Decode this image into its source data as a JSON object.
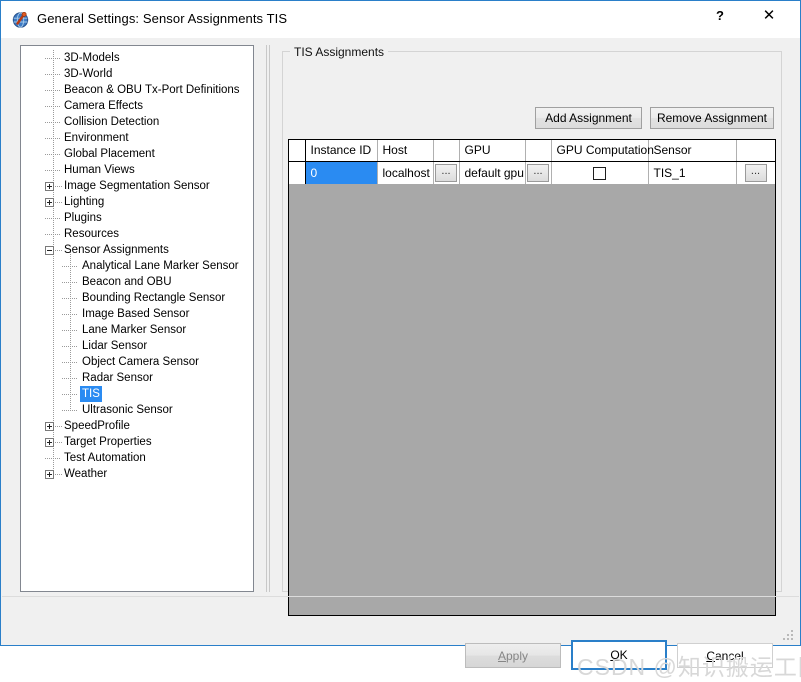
{
  "window": {
    "title": "General Settings: Sensor Assignments TIS",
    "icon": "globe-sensor-icon",
    "help_label": "?",
    "close_label": "✕",
    "accent_color": "#2a7fc9",
    "selection_color": "#2a8bf2"
  },
  "tree": {
    "items": [
      {
        "label": "3D-Models",
        "depth": 1,
        "expander": "none",
        "selected": false
      },
      {
        "label": "3D-World",
        "depth": 1,
        "expander": "none",
        "selected": false
      },
      {
        "label": "Beacon & OBU Tx-Port Definitions",
        "depth": 1,
        "expander": "none",
        "selected": false
      },
      {
        "label": "Camera Effects",
        "depth": 1,
        "expander": "none",
        "selected": false
      },
      {
        "label": "Collision Detection",
        "depth": 1,
        "expander": "none",
        "selected": false
      },
      {
        "label": "Environment",
        "depth": 1,
        "expander": "none",
        "selected": false
      },
      {
        "label": "Global Placement",
        "depth": 1,
        "expander": "none",
        "selected": false
      },
      {
        "label": "Human Views",
        "depth": 1,
        "expander": "none",
        "selected": false
      },
      {
        "label": "Image Segmentation Sensor",
        "depth": 1,
        "expander": "plus",
        "selected": false
      },
      {
        "label": "Lighting",
        "depth": 1,
        "expander": "plus",
        "selected": false
      },
      {
        "label": "Plugins",
        "depth": 1,
        "expander": "none",
        "selected": false
      },
      {
        "label": "Resources",
        "depth": 1,
        "expander": "none",
        "selected": false
      },
      {
        "label": "Sensor Assignments",
        "depth": 1,
        "expander": "minus",
        "selected": false
      },
      {
        "label": "Analytical Lane Marker Sensor",
        "depth": 2,
        "expander": "none",
        "selected": false
      },
      {
        "label": "Beacon and OBU",
        "depth": 2,
        "expander": "none",
        "selected": false
      },
      {
        "label": "Bounding Rectangle Sensor",
        "depth": 2,
        "expander": "none",
        "selected": false
      },
      {
        "label": "Image Based Sensor",
        "depth": 2,
        "expander": "none",
        "selected": false
      },
      {
        "label": "Lane Marker Sensor",
        "depth": 2,
        "expander": "none",
        "selected": false
      },
      {
        "label": "Lidar Sensor",
        "depth": 2,
        "expander": "none",
        "selected": false
      },
      {
        "label": "Object Camera Sensor",
        "depth": 2,
        "expander": "none",
        "selected": false
      },
      {
        "label": "Radar Sensor",
        "depth": 2,
        "expander": "none",
        "selected": false
      },
      {
        "label": "TIS",
        "depth": 2,
        "expander": "none",
        "selected": true
      },
      {
        "label": "Ultrasonic Sensor",
        "depth": 2,
        "expander": "none",
        "selected": false
      },
      {
        "label": "SpeedProfile",
        "depth": 1,
        "expander": "plus",
        "selected": false
      },
      {
        "label": "Target Properties",
        "depth": 1,
        "expander": "plus",
        "selected": false
      },
      {
        "label": "Test Automation",
        "depth": 1,
        "expander": "none",
        "selected": false
      },
      {
        "label": "Weather",
        "depth": 1,
        "expander": "plus",
        "selected": false
      }
    ]
  },
  "panel": {
    "group_title": "TIS Assignments",
    "add_button": "Add Assignment",
    "remove_button": "Remove Assignment",
    "table": {
      "columns": [
        "",
        "Instance ID",
        "Host",
        "",
        "GPU",
        "",
        "GPU Computation",
        "Sensor",
        ""
      ],
      "rows": [
        {
          "instance_id": "0",
          "host": "localhost",
          "host_browse": "...",
          "gpu": "default gpu",
          "gpu_browse": "...",
          "gpu_computation_checked": false,
          "sensor": "TIS_1",
          "sensor_browse": "..."
        }
      ],
      "empty_background_color": "#a8a8a8"
    }
  },
  "footer": {
    "apply_label": "Apply",
    "apply_enabled": false,
    "ok_label": "OK",
    "cancel_label": "Cancel",
    "default_button": "OK"
  },
  "watermark": {
    "text": "CSDN @知识搬运工阿杰"
  }
}
